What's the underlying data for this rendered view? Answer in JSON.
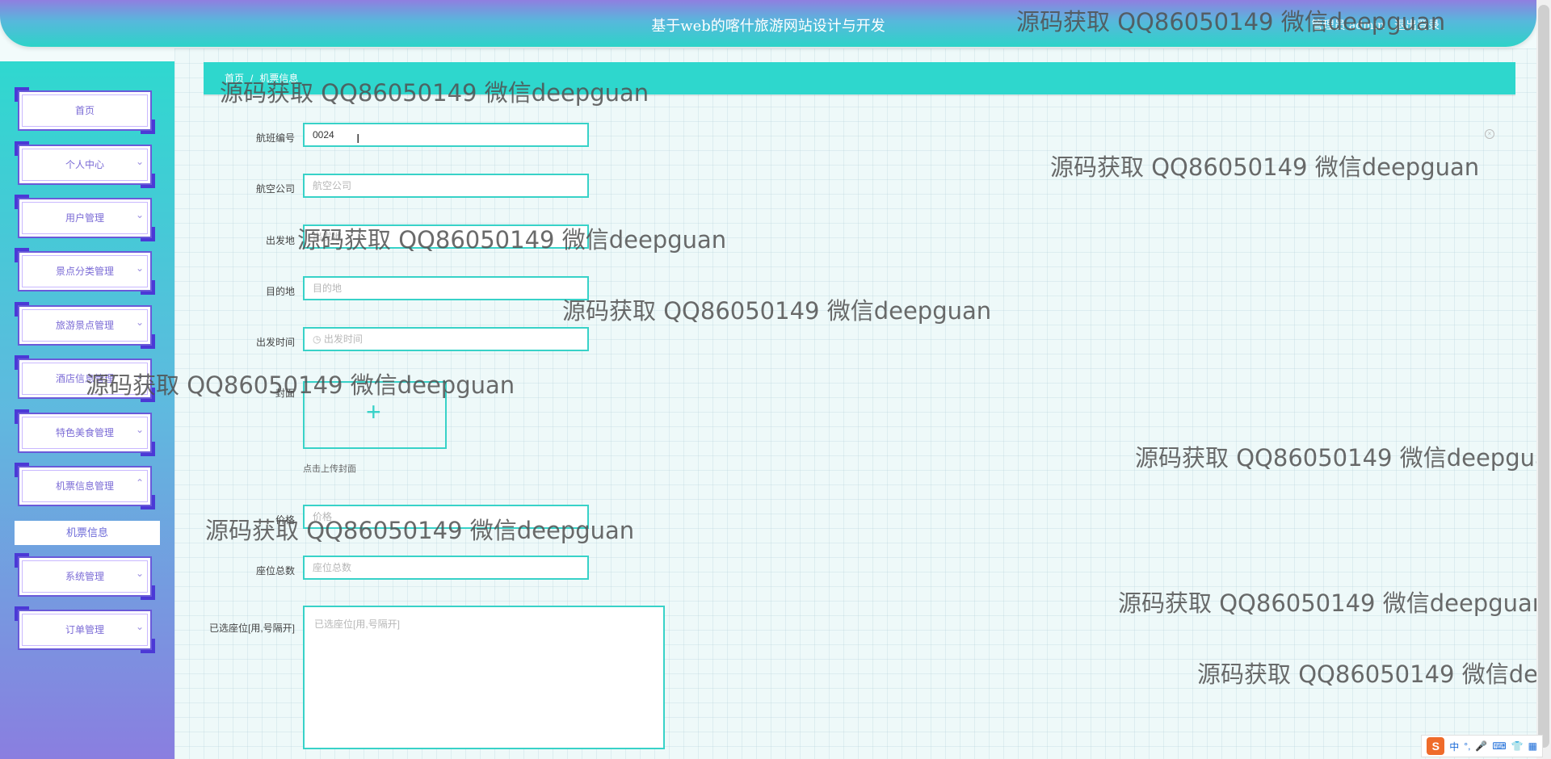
{
  "header": {
    "title": "基于web的喀什旅游网站设计与开发",
    "user_label": "管理员 admin",
    "logout_label": "退出登录"
  },
  "sidebar": {
    "items": [
      {
        "label": "首页",
        "chevron": ""
      },
      {
        "label": "个人中心",
        "chevron": "⌄"
      },
      {
        "label": "用户管理",
        "chevron": "⌄"
      },
      {
        "label": "景点分类管理",
        "chevron": "⌄"
      },
      {
        "label": "旅游景点管理",
        "chevron": "⌄"
      },
      {
        "label": "酒店信息管理",
        "chevron": "⌄"
      },
      {
        "label": "特色美食管理",
        "chevron": "⌄"
      },
      {
        "label": "机票信息管理",
        "chevron": "⌃"
      },
      {
        "label": "系统管理",
        "chevron": "⌄"
      },
      {
        "label": "订单管理",
        "chevron": "⌄"
      }
    ],
    "subitem": "机票信息"
  },
  "breadcrumb": {
    "home": "首页",
    "sep": "/",
    "current": "机票信息"
  },
  "form": {
    "flight_no_label": "航班编号",
    "flight_no_value": "0024",
    "airline_label": "航空公司",
    "airline_placeholder": "航空公司",
    "departure_label": "出发地",
    "departure_placeholder": "出发地",
    "destination_label": "目的地",
    "destination_placeholder": "目的地",
    "depart_time_label": "出发时间",
    "depart_time_placeholder": "出发时间",
    "cover_label": "封面",
    "cover_hint": "点击上传封面",
    "price_label": "价格",
    "price_placeholder": "价格",
    "seats_label": "座位总数",
    "seats_placeholder": "座位总数",
    "selected_seats_label": "已选座位[用,号隔开]",
    "selected_seats_placeholder": "已选座位[用,号隔开]"
  },
  "watermark": {
    "text": "源码获取 QQ86050149 微信deepguan"
  },
  "tray": {
    "logo": "S",
    "items": [
      "中",
      "°,",
      "🎤",
      "⌨",
      "👕",
      "▦"
    ]
  },
  "colors": {
    "accent": "#2ed7cd",
    "menu_border": "#6a5ad9",
    "header_top": "#8f7fe0"
  }
}
